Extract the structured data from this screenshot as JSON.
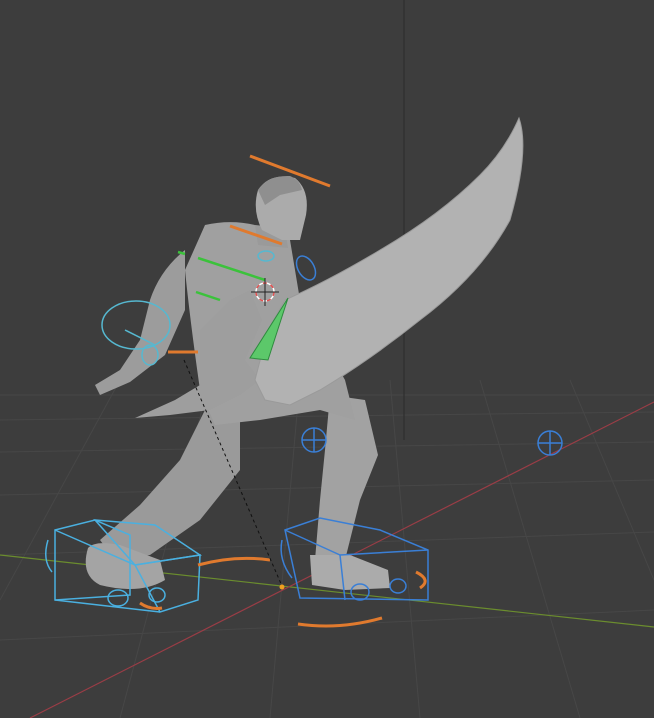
{
  "viewport": {
    "background": "#3d3d3d",
    "grid_color": "#474747",
    "x_axis_color": "#9a3d46",
    "y_axis_color": "#6b8d2e",
    "z_axis_color": "#2a2a2a"
  },
  "model": {
    "mesh_color": "#a8a8a8",
    "mesh_shadow": "#7e7e7e",
    "blade_color": "#b0b0b0"
  },
  "rig_colors": {
    "ik_foot_left": "#4ab0e0",
    "ik_foot_right": "#3a7fd6",
    "fk_orange": "#e07a2e",
    "spine_green": "#3bc23b",
    "hand_cyan": "#56b8d0",
    "pole_target": "#3a7fd6",
    "cursor": "#e05050"
  },
  "icons": {
    "pole_target_knee_left": "crosshair-circle-icon",
    "pole_target_knee_right": "crosshair-circle-icon",
    "origin_point": "origin-dot-icon",
    "3d_cursor": "3d-cursor-icon"
  }
}
